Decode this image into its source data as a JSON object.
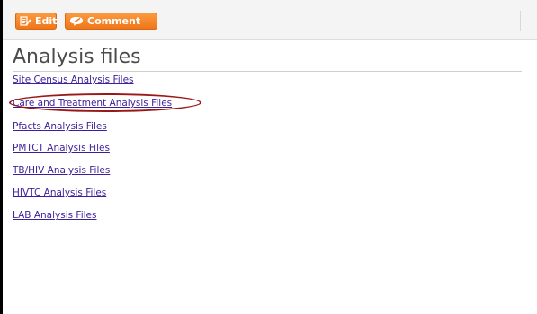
{
  "toolbar": {
    "edit_label": "Edit",
    "comment_label": "Comment",
    "button_color": "#f0761a"
  },
  "page": {
    "title": "Analysis files"
  },
  "links": [
    {
      "label": "Site Census Analysis Files"
    },
    {
      "label": "Care and Treatment Analysis Files"
    },
    {
      "label": "Pfacts Analysis Files"
    },
    {
      "label": "PMTCT Analysis Files"
    },
    {
      "label": "TB/HIV Analysis Files"
    },
    {
      "label": "HIVTC Analysis Files"
    },
    {
      "label": "LAB Analysis Files"
    }
  ],
  "annotation": {
    "circled_item": "Care and Treatment Analysis Files",
    "color": "#9b1818"
  },
  "colors": {
    "link": "#3c1f9a",
    "heading": "#4a4a4a"
  }
}
